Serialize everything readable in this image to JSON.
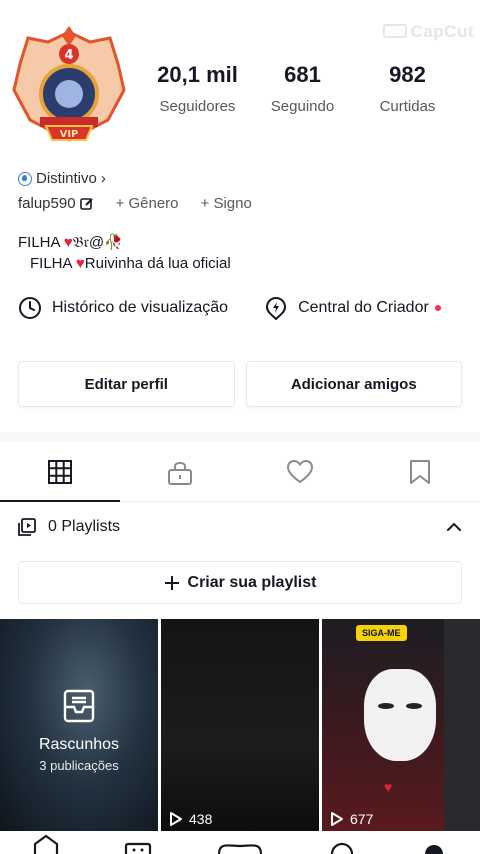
{
  "watermark": {
    "text": "CapCut"
  },
  "stats": [
    {
      "value": "20,1 mil",
      "label": "Seguidores"
    },
    {
      "value": "681",
      "label": "Seguindo"
    },
    {
      "value": "982",
      "label": "Curtidas"
    }
  ],
  "badge": {
    "label": "Distintivo",
    "chevron": "›"
  },
  "profile": {
    "username": "falup590",
    "add_gender": "+ Gênero",
    "add_sign": "+ Signo"
  },
  "bio": {
    "line1_prefix": "FILHA ",
    "line1_suffix": "𝔅𝔯@🥀",
    "line2_prefix": "FILHA ",
    "line2_suffix": "Ruivinha  dá    lua oficial"
  },
  "links": {
    "history": "Histórico de visualização",
    "creator": "Central do Criador"
  },
  "buttons": {
    "edit_profile": "Editar perfil",
    "add_friends": "Adicionar amigos"
  },
  "playlists": {
    "count_label": "0 Playlists",
    "create_label": "Criar sua playlist"
  },
  "grid": {
    "drafts_title": "Rascunhos",
    "drafts_sub": "3 publicações",
    "video2_plays": "438",
    "video3_plays": "677",
    "video3_sticker": "SIGA-ME"
  },
  "colors": {
    "accent": "#fe2c55",
    "heart": "#e32636",
    "badge": "#3b7bdc"
  }
}
